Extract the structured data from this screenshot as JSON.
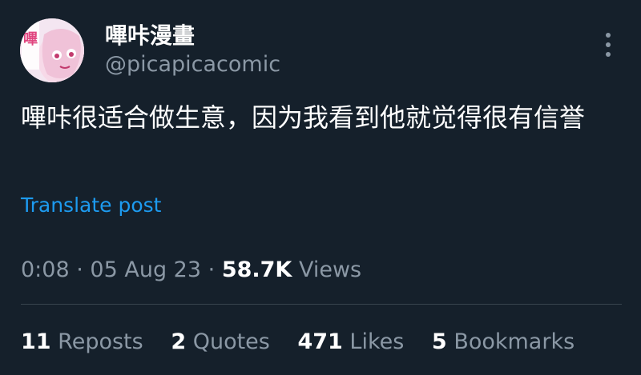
{
  "post": {
    "author": {
      "display_name": "嗶咔漫畫",
      "handle": "@picapicacomic",
      "avatar_label": "嗶"
    },
    "text": "嗶咔很适合做生意，因为我看到他就觉得很有信誉",
    "translate_label": "Translate post",
    "time": "0:08",
    "date": "05 Aug 23",
    "separator": "·",
    "views_count": "58.7K",
    "views_label": "Views",
    "stats": {
      "reposts_count": "11",
      "reposts_label": "Reposts",
      "quotes_count": "2",
      "quotes_label": "Quotes",
      "likes_count": "471",
      "likes_label": "Likes",
      "bookmarks_count": "5",
      "bookmarks_label": "Bookmarks"
    },
    "more_icon": "more-vertical-icon"
  },
  "colors": {
    "background": "#15202b",
    "text_primary": "#ffffff",
    "text_secondary": "#8b98a5",
    "link": "#1d9bf0",
    "divider": "#38444d"
  }
}
